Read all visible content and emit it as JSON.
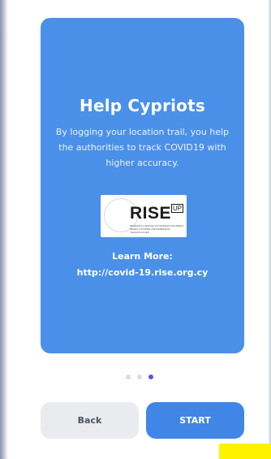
{
  "onboarding": {
    "title": "Help Cypriots",
    "description": "By logging your location trail, you help the authorities to track COVID19 with higher accuracy.",
    "logo": {
      "wordmark": "RISE",
      "superscript": "UP",
      "tagline": "RESEARCH CENTRE ON INTERACTIVE MEDIA SMART SYSTEMS AND EMERGING TECHNOLOGIES"
    },
    "learn_more_label": "Learn More:",
    "learn_more_link": "http://covid-19.rise.org.cy"
  },
  "pagination": {
    "total": 3,
    "active_index": 2
  },
  "buttons": {
    "back_label": "Back",
    "start_label": "START"
  },
  "colors": {
    "card": "#4a90e8",
    "start_button": "#3f86e6",
    "back_button": "#e9ebef",
    "active_dot": "#5b54d6",
    "inactive_dot": "#d9dce3",
    "corner_marker": "#fff200"
  }
}
